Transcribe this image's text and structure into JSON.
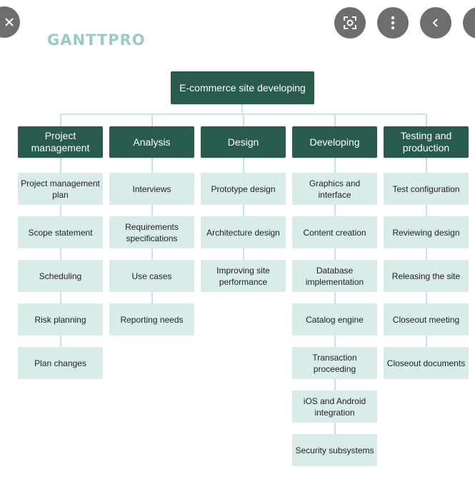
{
  "logo": "GANTTPRO",
  "controls": {
    "close": "close-icon",
    "lens": "lens-icon",
    "more": "more-icon",
    "back": "back-icon"
  },
  "root": "E-commerce site developing",
  "columns": [
    {
      "title": "Project management",
      "items": [
        "Project management plan",
        "Scope statement",
        "Scheduling",
        "Risk planning",
        "Plan changes"
      ]
    },
    {
      "title": "Analysis",
      "items": [
        "Interviews",
        "Requirements specifications",
        "Use cases",
        "Reporting needs"
      ]
    },
    {
      "title": "Design",
      "items": [
        "Prototype design",
        "Architecture design",
        "Improving site performance"
      ]
    },
    {
      "title": "Developing",
      "items": [
        "Graphics and interface",
        "Content creation",
        "Database implementation",
        "Catalog engine",
        "Transaction proceeding",
        "iOS and Android integration",
        "Security subsystems"
      ]
    },
    {
      "title": "Testing and production",
      "items": [
        "Test configuration",
        "Reviewing design",
        "Releasing the site",
        "Closeout meeting",
        "Closeout documents"
      ]
    }
  ]
}
